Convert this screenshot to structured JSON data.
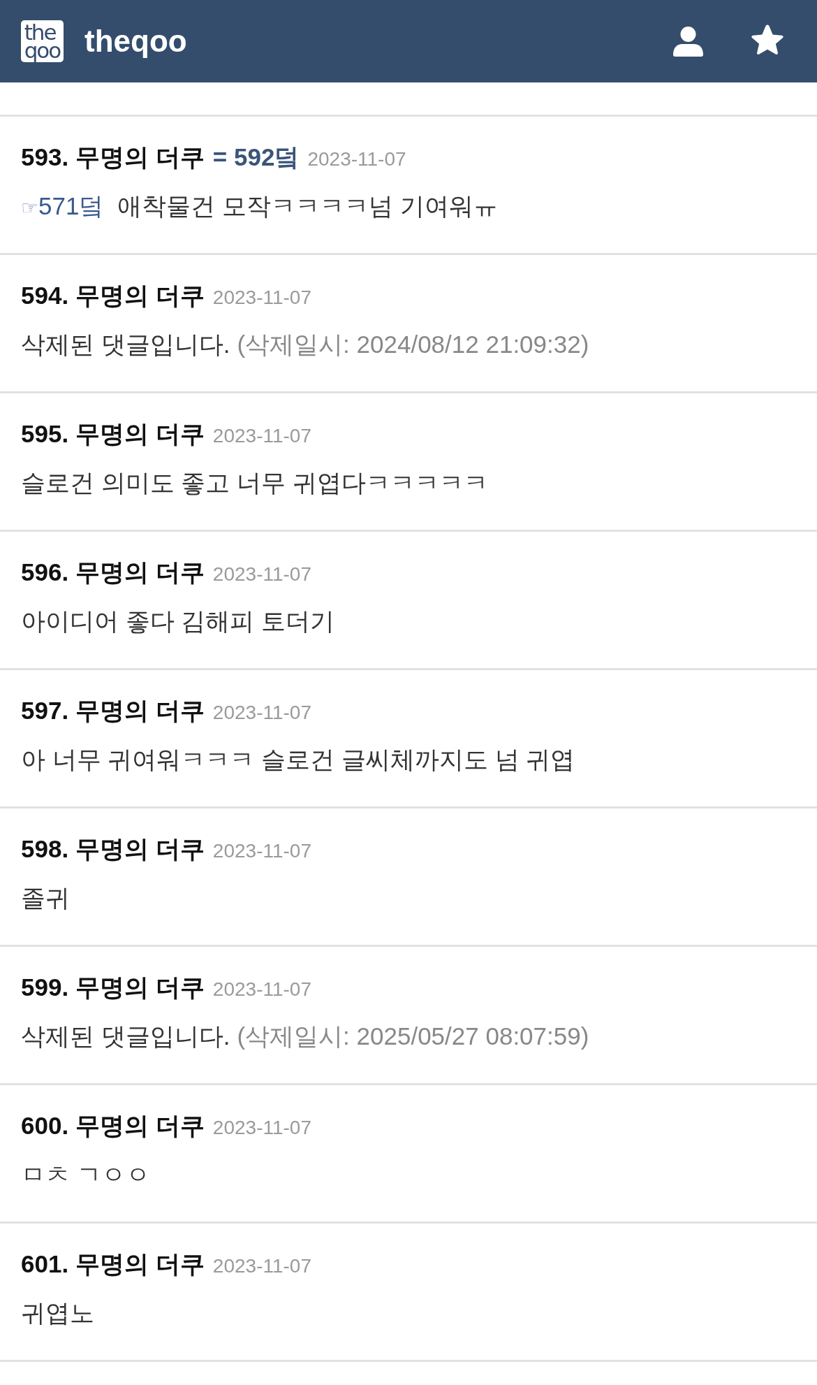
{
  "header": {
    "logo_lines": [
      "the",
      "qoo"
    ],
    "title": "theqoo"
  },
  "comments": [
    {
      "number": "593.",
      "author": "무명의 더쿠",
      "reply_to": "= 592덬",
      "date": "2023-11-07",
      "quote_pointer": "☞",
      "quote_target": "571덬",
      "body": "애착물건 모작ㅋㅋㅋㅋ넘 기여워ㅠ"
    },
    {
      "number": "594.",
      "author": "무명의 더쿠",
      "date": "2023-11-07",
      "body": "삭제된 댓글입니다.",
      "deleted_at": "(삭제일시: 2024/08/12 21:09:32)"
    },
    {
      "number": "595.",
      "author": "무명의 더쿠",
      "date": "2023-11-07",
      "body": "슬로건 의미도 좋고 너무 귀엽다ㅋㅋㅋㅋㅋ"
    },
    {
      "number": "596.",
      "author": "무명의 더쿠",
      "date": "2023-11-07",
      "body": "아이디어 좋다 김해피 토더기"
    },
    {
      "number": "597.",
      "author": "무명의 더쿠",
      "date": "2023-11-07",
      "body": "아 너무 귀여워ㅋㅋㅋ 슬로건 글씨체까지도 넘 귀엽"
    },
    {
      "number": "598.",
      "author": "무명의 더쿠",
      "date": "2023-11-07",
      "body": "졸귀"
    },
    {
      "number": "599.",
      "author": "무명의 더쿠",
      "date": "2023-11-07",
      "body": "삭제된 댓글입니다.",
      "deleted_at": "(삭제일시: 2025/05/27 08:07:59)"
    },
    {
      "number": "600.",
      "author": "무명의 더쿠",
      "date": "2023-11-07",
      "body": "ㅁㅊ ㄱㅇㅇ"
    },
    {
      "number": "601.",
      "author": "무명의 더쿠",
      "date": "2023-11-07",
      "body": "귀엽노"
    }
  ]
}
